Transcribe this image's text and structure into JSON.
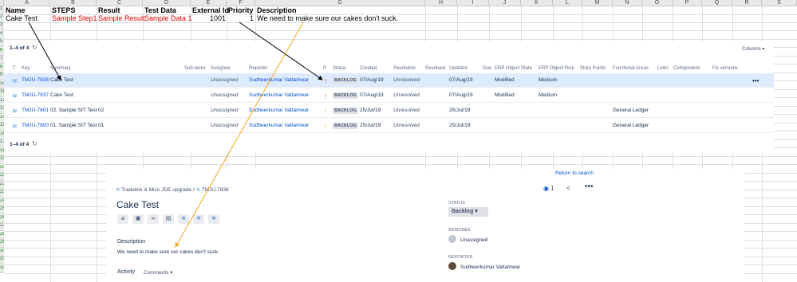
{
  "sheet": {
    "columns": [
      "A",
      "B",
      "C",
      "D",
      "E",
      "F",
      "G",
      "H",
      "I",
      "J",
      "K",
      "L",
      "M",
      "N",
      "O",
      "P",
      "Q",
      "R",
      "S"
    ],
    "rows": [
      "1",
      "2",
      "3",
      "4",
      "5",
      "6",
      "7",
      "8",
      "9",
      "10",
      "11",
      "12",
      "13",
      "14",
      "15",
      "16",
      "17",
      "18",
      "19",
      "20",
      "21",
      "22",
      "23",
      "24",
      "25",
      "26",
      "27",
      "28",
      "29",
      "30",
      "31",
      "32"
    ],
    "headers": {
      "name": "Name",
      "steps": "STEPS",
      "result": "Result",
      "test_data": "Test Data",
      "external_id": "External Id",
      "priority": "Priority",
      "description": "Description"
    },
    "row2": {
      "name": "Cake Test",
      "steps": "Sample Step1",
      "result": "Sample Result",
      "test_data": "Sample Data 1",
      "external_id": "1001",
      "priority": "1",
      "description": "We need to make sure our cakes don't suck."
    }
  },
  "list": {
    "count_top": "1–4 of 4",
    "count_bottom": "1–4 of 4",
    "columns_label": "Columns",
    "headers": [
      "T",
      "Key",
      "Summary",
      "Sub-tasks",
      "Assignee",
      "Reporter",
      "P",
      "Status",
      "Created",
      "Resolution",
      "Resolved",
      "Updated",
      "Due",
      "ERP Object State",
      "ERP Object Risk",
      "Story Points",
      "Functional Areas",
      "Links",
      "Components",
      "Fix versions"
    ],
    "rows": [
      {
        "key": "TMJU-7938",
        "summary": "Cake Test",
        "assignee": "Unassigned",
        "reporter": "Sudheerkumar Vattamwar",
        "status": "BACKLOG",
        "created": "07/Aug/19",
        "resolution": "Unresolved",
        "updated": "07/Aug/19",
        "erp_state": "Modified",
        "erp_risk": "Medium",
        "functional": "",
        "priority_color": "#e5493a"
      },
      {
        "key": "TMJU-7937",
        "summary": "Cake Test",
        "assignee": "Unassigned",
        "reporter": "Sudheerkumar Vattamwar",
        "status": "BACKLOG",
        "created": "07/Aug/19",
        "resolution": "Unresolved",
        "updated": "07/Aug/19",
        "erp_state": "Modified",
        "erp_risk": "Medium",
        "functional": "",
        "priority_color": "#e5493a"
      },
      {
        "key": "TMJU-7801",
        "summary": "02. Sample SIT Test 02",
        "assignee": "Unassigned",
        "reporter": "Sudheerkumar Vattamwar",
        "status": "BACKLOG",
        "created": "25/Jul/19",
        "resolution": "Unresolved",
        "updated": "25/Jul/19",
        "erp_state": "",
        "erp_risk": "",
        "functional": "General Ledger",
        "priority_color": "#f79232"
      },
      {
        "key": "TMJU-7800",
        "summary": "01. Sample SIT Test 01",
        "assignee": "Unassigned",
        "reporter": "Sudheerkumar Vattamwar",
        "status": "BACKLOG",
        "created": "25/Jul/19",
        "resolution": "Unresolved",
        "updated": "25/Jul/19",
        "erp_state": "",
        "erp_risk": "",
        "functional": "General Ledger",
        "priority_color": "#f79232"
      }
    ]
  },
  "detail": {
    "return_link": "Return to search",
    "breadcrumb_project": "Tradelink & Mico JDE upgrade",
    "breadcrumb_sep": "/",
    "breadcrumb_issue": "TMJU-7938",
    "watch_count": "1",
    "title": "Cake Test",
    "description_label": "Description",
    "description": "We need to make sure our cakes don't suck.",
    "activity_label": "Activity",
    "activity_tab": "Comments",
    "status_label": "STATUS",
    "status_value": "Backlog",
    "assignee_label": "ASSIGNEE",
    "assignee_value": "Unassigned",
    "reporter_label": "REPORTER",
    "reporter_value": "Sudheerkumar Vattamwar"
  },
  "colors": {
    "arrow_black": "#000000",
    "arrow_yellow": "#f5a623",
    "link": "#0052cc",
    "selected_row": "#deebff"
  }
}
